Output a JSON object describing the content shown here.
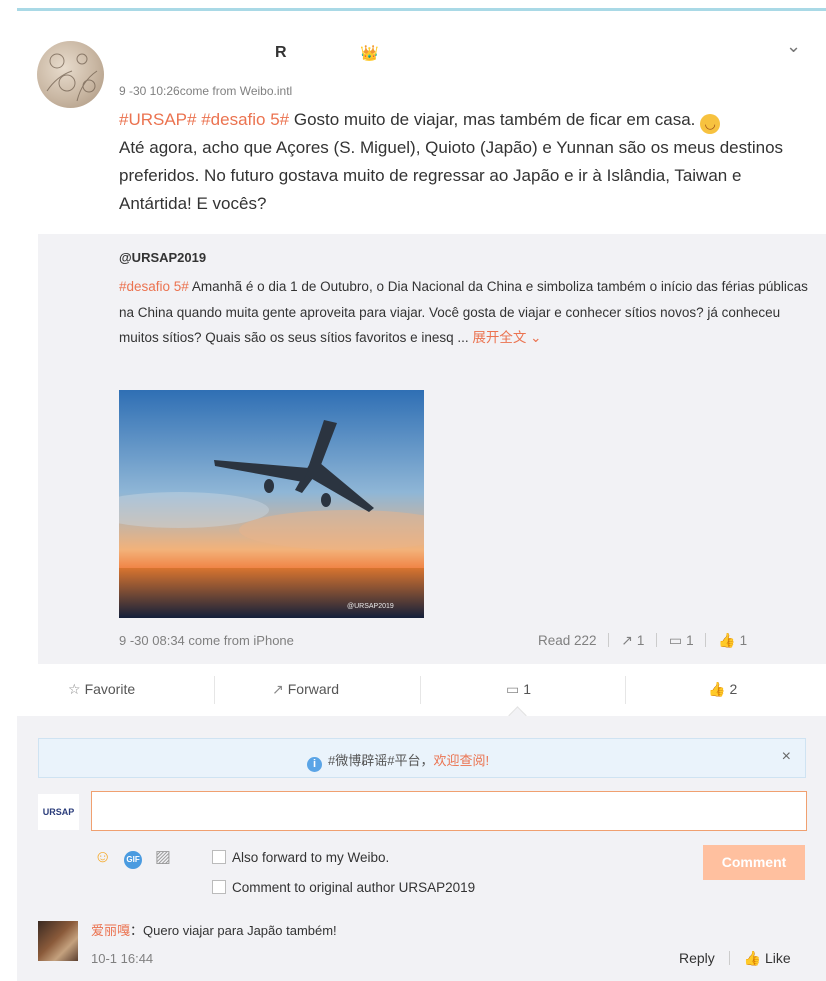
{
  "post": {
    "username": "R",
    "badge_icon": "crown-icon",
    "meta": "9 -30 10:26come from Weibo.intl",
    "tags": [
      "#URSAP#",
      "#desafio 5#"
    ],
    "text": " Gosto muito de viajar, mas também de ficar em casa. ",
    "text2": "Até agora, acho que Açores (S. Miguel), Quioto (Japão) e Yunnan são os meus destinos preferidos.   No futuro gostava muito de regressar ao Japão e ir à Islândia, Taiwan e Antártida! E vocês?"
  },
  "repost": {
    "author": "@URSAP2019",
    "tag": "#desafio 5#",
    "text": " Amanhã é o dia 1 de Outubro, o Dia Nacional da  China e simboliza também o início das férias públicas na China quando muita gente aproveita para viajar. Você gosta de viajar e conhecer sítios novos? já conheceu muitos sítios? Quais são os seus sítios favoritos e inesq ... ",
    "expand": "展开全文 ⌄",
    "watermark": "@URSAP2019",
    "time": "9 -30 08:34 come from iPhone",
    "read": "Read 222",
    "forward_count": "1",
    "comment_count": "1",
    "like_count": "1"
  },
  "actions": {
    "favorite": "Favorite",
    "forward": "Forward",
    "comment_count": "1",
    "like_count": "2"
  },
  "notice": {
    "text": "#微博辟谣#平台，",
    "link": "欢迎查阅!",
    "close": "×"
  },
  "composer": {
    "logo": "URSAP",
    "input_value": "",
    "opt_forward": "Also forward to my Weibo.",
    "opt_original": "Comment to original author URSAP2019",
    "submit": "Comment"
  },
  "comment": {
    "name": "爱丽嘎",
    "text": "：Quero viajar para Japão também!",
    "time": "10-1 16:44",
    "reply": "Reply",
    "like": "Like"
  },
  "colors": {
    "accent": "#eb7350",
    "link_blue": "#5aa4e6",
    "button_disabled": "#ffc09f"
  }
}
